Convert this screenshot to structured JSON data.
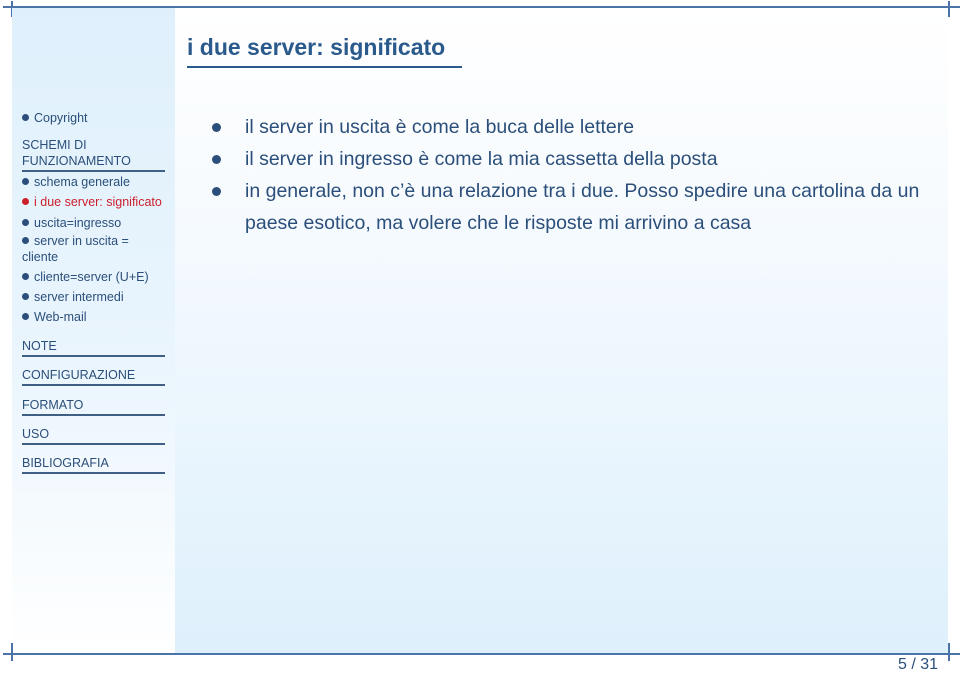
{
  "slide": {
    "title": "i due server: significato",
    "page_number": "5 / 31"
  },
  "sidebar": {
    "top_items": [
      {
        "label": "Copyright",
        "bullet": true,
        "active": false
      }
    ],
    "sections": [
      {
        "label": "SCHEMI DI FUNZIONAMENTO",
        "items": [
          {
            "label": "schema generale",
            "active": false
          },
          {
            "label": "i due server: significato",
            "active": true
          },
          {
            "label": "uscita=ingresso",
            "active": false
          },
          {
            "label": "server in uscita = cliente",
            "active": false
          },
          {
            "label": "cliente=server (U+E)",
            "active": false
          },
          {
            "label": "server intermedi",
            "active": false
          },
          {
            "label": "Web-mail",
            "active": false
          }
        ]
      },
      {
        "label": "NOTE"
      },
      {
        "label": "CONFIGURAZIONE"
      },
      {
        "label": "FORMATO"
      },
      {
        "label": "USO"
      },
      {
        "label": "BIBLIOGRAFIA"
      }
    ]
  },
  "content": {
    "bullets": [
      "il server in uscita è come la buca delle lettere",
      "il server in ingresso è come la mia cassetta della posta",
      "in generale, non c’è una relazione tra i due. Posso spedire una cartolina da un paese esotico, ma volere che le risposte mi arrivino a casa"
    ]
  },
  "colors": {
    "accent": "#2a5a8c",
    "text": "#2b4f7a",
    "active": "#cc1f2c",
    "sidebar_bg": "#dff0fc"
  }
}
